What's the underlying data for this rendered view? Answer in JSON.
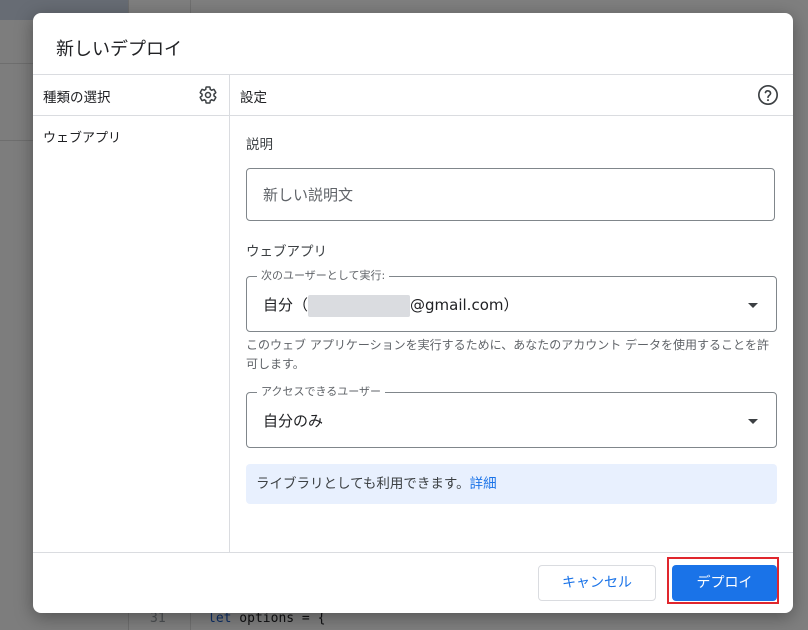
{
  "background": {
    "code_line_number": "31",
    "code_keyword": "let",
    "code_text": " options = {"
  },
  "dialog": {
    "title": "新しいデプロイ",
    "type_panel": {
      "header": "種類の選択",
      "items": [
        "ウェブアプリ"
      ]
    },
    "settings": {
      "header": "設定",
      "description_label": "説明",
      "description_placeholder": "新しい説明文",
      "webapp_section": "ウェブアプリ",
      "execute_as": {
        "legend": "次のユーザーとして実行:",
        "value_prefix": "自分（",
        "value_suffix": "@gmail.com）"
      },
      "execute_helper": "このウェブ アプリケーションを実行するために、あなたのアカウント データを使用することを許可します。",
      "access": {
        "legend": "アクセスできるユーザー",
        "value": "自分のみ"
      },
      "info_text": "ライブラリとしても利用できます。",
      "info_link": "詳細"
    },
    "buttons": {
      "cancel": "キャンセル",
      "deploy": "デプロイ"
    }
  },
  "colors": {
    "accent": "#1a73e8",
    "highlight": "#e0262d",
    "info_bg": "#e8f0fe"
  }
}
